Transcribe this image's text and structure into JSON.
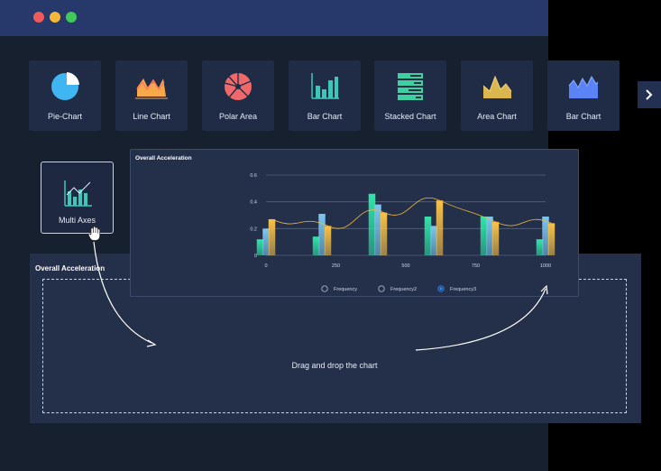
{
  "window": {
    "traffic_lights": [
      "#ef5a5a",
      "#f4b93a",
      "#3ec95a"
    ]
  },
  "chart_types": [
    {
      "label": "Pie-Chart",
      "icon": "pie-chart-icon"
    },
    {
      "label": "Line Chart",
      "icon": "line-chart-icon"
    },
    {
      "label": "Polar Area",
      "icon": "polar-area-icon"
    },
    {
      "label": "Bar Chart",
      "icon": "bar-chart-icon"
    },
    {
      "label": "Stacked Chart",
      "icon": "stacked-chart-icon"
    },
    {
      "label": "Area Chart",
      "icon": "area-chart-icon"
    },
    {
      "label": "Bar Chart",
      "icon": "bar-chart-wave-icon"
    }
  ],
  "dragged_tile": {
    "label": "Multi Axes",
    "icon": "multi-axes-icon"
  },
  "drop_panel": {
    "title": "Overall Acceleration",
    "hint": "Drag and drop the chart"
  },
  "colors": {
    "accent": "#2f8bf0",
    "green": "#2ee6a8",
    "blue": "#7cc7f0",
    "yellow": "#f8c24a"
  },
  "chart_data": {
    "type": "bar",
    "title": "Overall Acceleration",
    "x_ticks": [
      "0",
      "250",
      "500",
      "750",
      "1000"
    ],
    "y_ticks": [
      "0",
      "0.2",
      "0.4",
      "0.6"
    ],
    "ylim": [
      0,
      0.6
    ],
    "xlim": [
      0,
      1000
    ],
    "x": [
      0,
      100,
      200,
      300,
      400,
      500,
      600,
      700,
      800,
      900,
      1000
    ],
    "series": [
      {
        "name": "Frequency",
        "values": [
          0.12,
          0.0,
          0.14,
          0.0,
          0.46,
          0.0,
          0.29,
          0.0,
          0.29,
          0.0,
          0.12
        ]
      },
      {
        "name": "Frequency2",
        "values": [
          0.2,
          0.0,
          0.31,
          0.0,
          0.38,
          0.0,
          0.22,
          0.0,
          0.29,
          0.0,
          0.29
        ]
      },
      {
        "name": "Frequency3",
        "values": [
          0.27,
          0.0,
          0.22,
          0.0,
          0.32,
          0.0,
          0.41,
          0.0,
          0.25,
          0.0,
          0.24
        ]
      }
    ],
    "legend": [
      "Frequency",
      "Frequency2",
      "Frequency3"
    ],
    "legend_selected": "Frequency3",
    "legend_position": "bottom",
    "grid": true
  }
}
